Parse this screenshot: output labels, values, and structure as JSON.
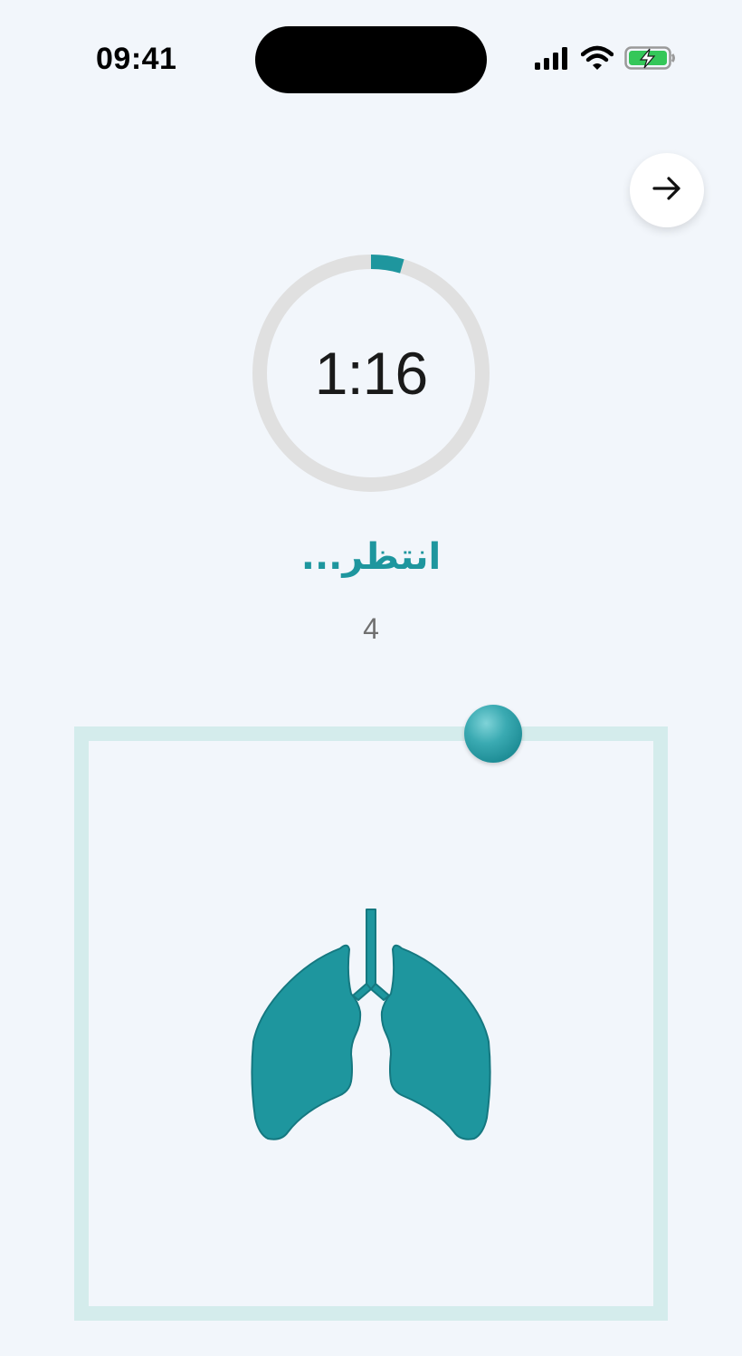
{
  "status_bar": {
    "time": "09:41",
    "icons": [
      "cellular-signal-icon",
      "wifi-icon",
      "battery-charging-icon"
    ]
  },
  "navigation": {
    "next_icon": "arrow-right-icon"
  },
  "timer": {
    "display": "1:16",
    "progress": 0.045
  },
  "breathing": {
    "phase_label": "انتظر...",
    "count": "4",
    "illustration": "lungs-icon"
  },
  "colors": {
    "accent": "#1e969e",
    "ring_track": "#e0e0e0",
    "box_border": "#d4ecec",
    "background": "#f2f6fb"
  }
}
